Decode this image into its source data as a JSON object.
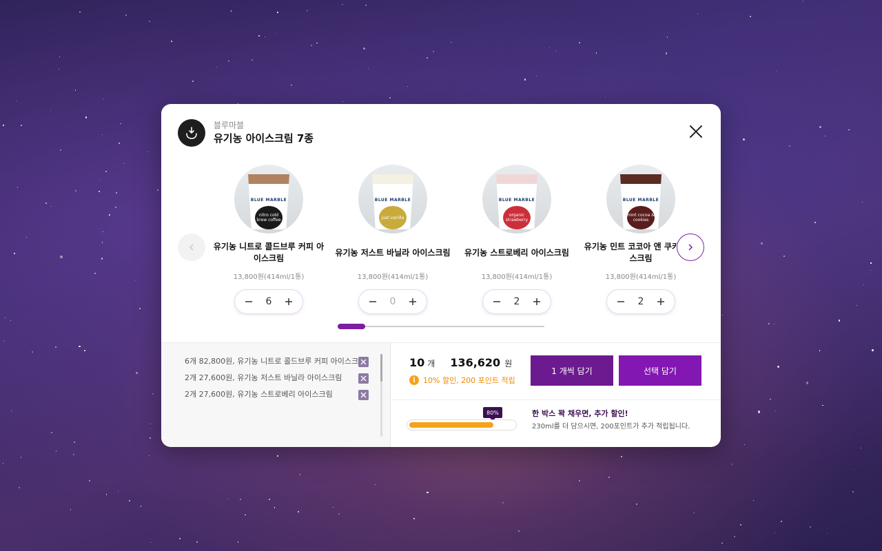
{
  "header": {
    "brand": "블루마블",
    "title": "유기농 아이스크림 7종"
  },
  "carousel": {
    "items": [
      {
        "name": "유기농 니트로 콜드브루 커피 아이스크림",
        "price": "13,800원(414ml/1통)",
        "quantity": "6",
        "cup_text": "nitro cold brew coffee",
        "label_color": "#1a1a1a",
        "top_color": "#b08260"
      },
      {
        "name": "유기농 저스트 바닐라 아이스크림",
        "price": "13,800원(414ml/1통)",
        "quantity": "0",
        "cup_text": "just vanilla",
        "label_color": "#c9ab3c",
        "top_color": "#f4f1e2"
      },
      {
        "name": "유기농 스트로베리 아이스크림",
        "price": "13,800원(414ml/1통)",
        "quantity": "2",
        "cup_text": "organic strawberry",
        "label_color": "#cc2f3a",
        "top_color": "#f1d6d8"
      },
      {
        "name": "유기농 민트 코코아 앤 쿠키 아이스크림",
        "price": "13,800원(414ml/1통)",
        "quantity": "2",
        "cup_text": "mint cocoa & cookies",
        "label_color": "#5a1d1d",
        "top_color": "#5a2c22"
      }
    ],
    "cup_brand": "BLUE MARBLE",
    "scroll_progress": 0.13
  },
  "cart": {
    "lines": [
      {
        "amount": "6개 82,800원",
        "name": ", 유기농 니트로 콜드브루 커피 아이스크림"
      },
      {
        "amount": "2개 27,600원",
        "name": ", 유기농 저스트 바닐라 아이스크림"
      },
      {
        "amount": "2개 27,600원",
        "name": ", 유기농 스트로베리 아이스크림"
      }
    ]
  },
  "summary": {
    "count": "10",
    "count_unit": "개",
    "total": "136,620",
    "currency": "원",
    "discount_text": "10% 할인, 200 포인트 적립"
  },
  "buttons": {
    "add_one_each": "1 개씩 담기",
    "add_selected": "선택 담기"
  },
  "promo": {
    "progress_label": "80%",
    "progress_value": 0.8,
    "title": "한 박스 꽉 채우면, 추가 할인!",
    "description": "230ml를 더 담으시면, 200포인트가 추가 적립됩니다."
  },
  "colors": {
    "accent": "#7b1fa2",
    "cta_primary": "#6c1a8f",
    "cta_secondary": "#8317b1",
    "progress": "#f5a21b"
  }
}
